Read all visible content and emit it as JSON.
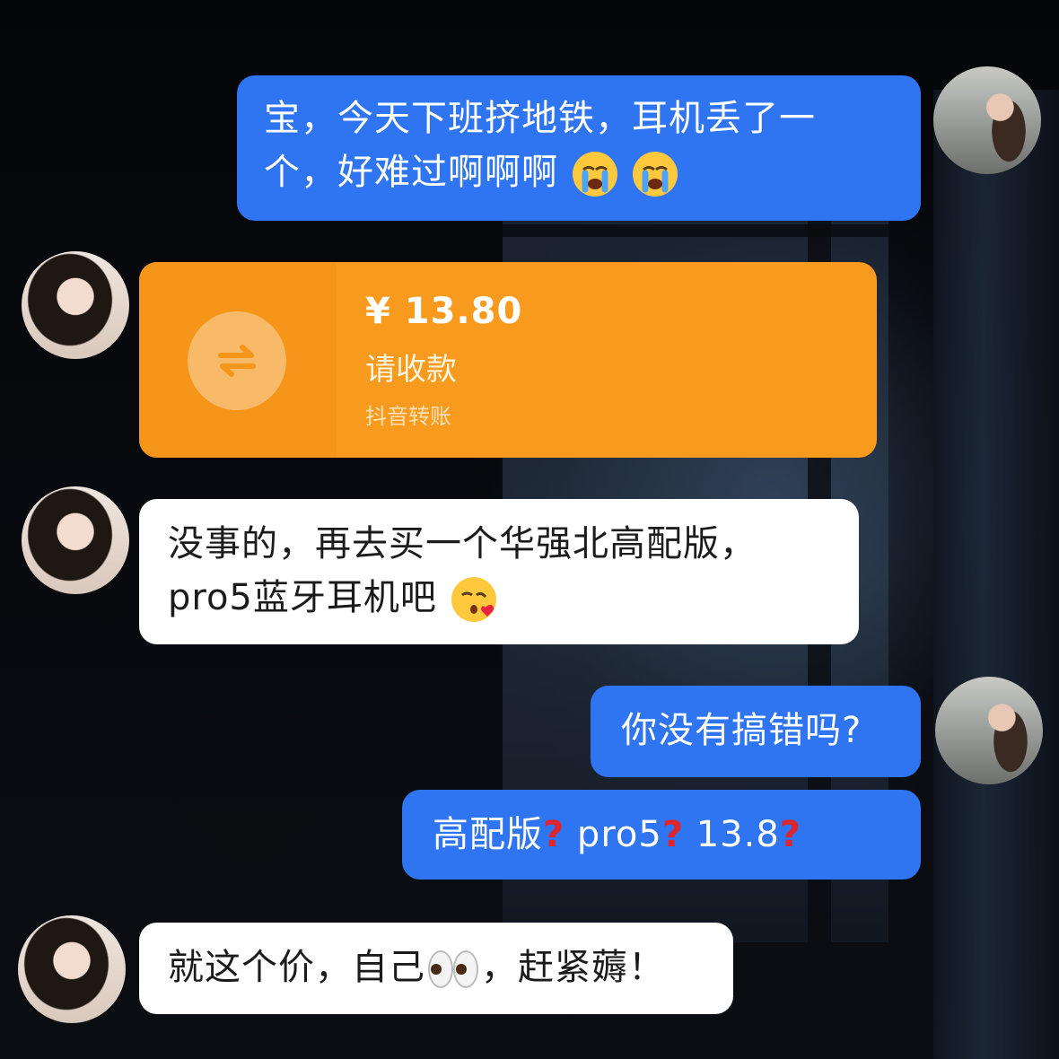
{
  "messages": [
    {
      "from": "self",
      "text_line1": "宝，今天下班挤地铁，耳机丢了一",
      "text_line2": "个，好难过啊啊啊",
      "emoji": [
        "crying-face",
        "crying-face"
      ]
    },
    {
      "from": "other",
      "type": "transfer",
      "amount": "¥ 13.80",
      "label": "请收款",
      "source": "抖音转账"
    },
    {
      "from": "other",
      "text_line1": "没事的，再去买一个华强北高配版，",
      "text_line2": "pro5蓝牙耳机吧",
      "emoji": [
        "kissing-face"
      ]
    },
    {
      "from": "self",
      "text": "你没有搞错吗?"
    },
    {
      "from": "self",
      "parts": [
        "高配版",
        "pro5",
        "13.8"
      ],
      "emoji": [
        "red-question-mark"
      ]
    },
    {
      "from": "other",
      "text_a": "就这个价，自己",
      "text_b": "，赶紧薅！",
      "emoji": [
        "eyes"
      ]
    }
  ],
  "colors": {
    "self_bubble": "#2f74f0",
    "other_bubble": "#ffffff",
    "transfer": "#f79a1e",
    "question_mark": "#e0242b"
  }
}
